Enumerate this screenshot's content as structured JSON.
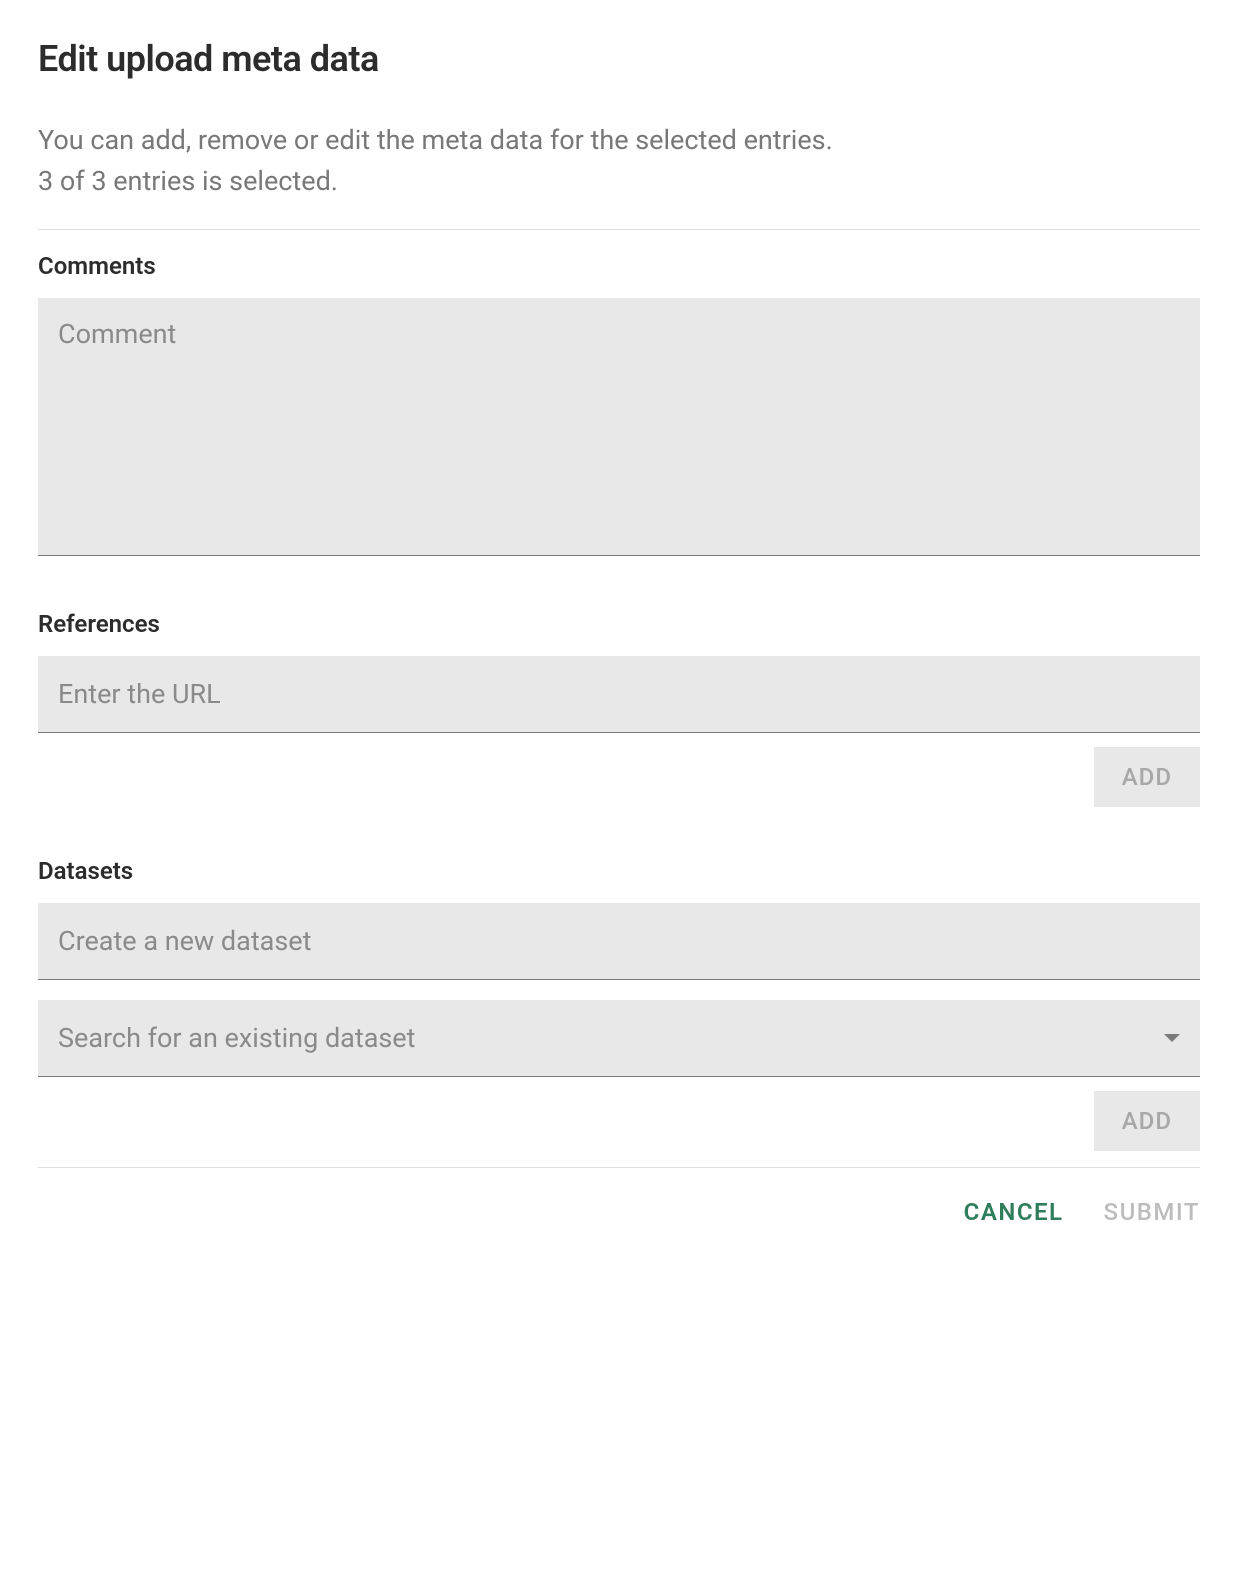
{
  "dialog": {
    "title": "Edit upload meta data",
    "description_line1": "You can add, remove or edit the meta data for the selected entries.",
    "description_line2": "3 of 3 entries is selected."
  },
  "comments": {
    "label": "Comments",
    "placeholder": "Comment",
    "value": ""
  },
  "references": {
    "label": "References",
    "placeholder": "Enter the URL",
    "value": "",
    "add_label": "ADD"
  },
  "datasets": {
    "label": "Datasets",
    "create_placeholder": "Create a new dataset",
    "create_value": "",
    "search_placeholder": "Search for an existing dataset",
    "add_label": "ADD"
  },
  "actions": {
    "cancel_label": "CANCEL",
    "submit_label": "SUBMIT"
  }
}
